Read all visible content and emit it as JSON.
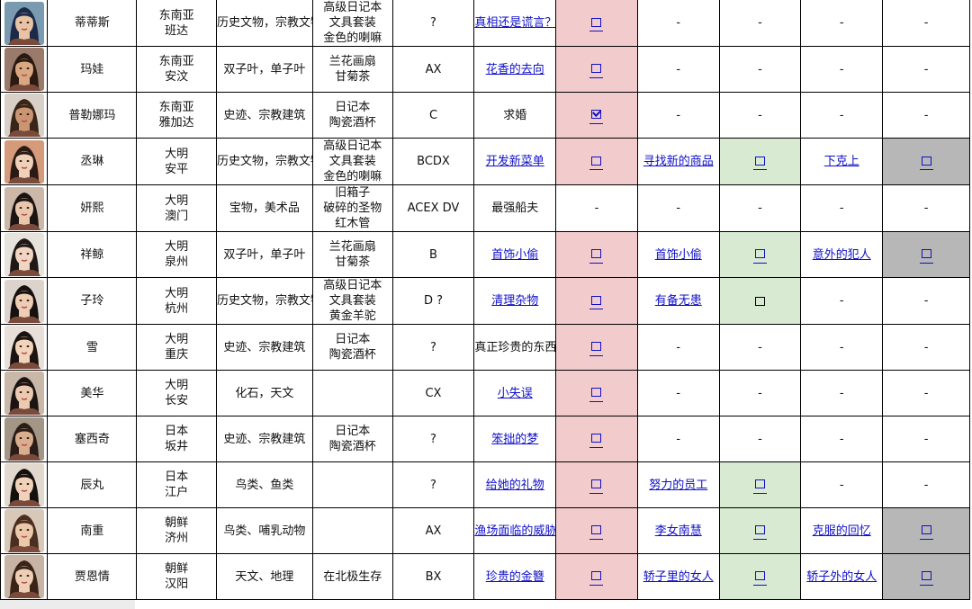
{
  "rows": [
    {
      "name": "蒂蒂斯",
      "region": "东南亚",
      "city": "班达",
      "interests": "历史文物，宗教文物",
      "items": [
        "高级日记本",
        "文具套装",
        "金色的喇嘛"
      ],
      "code": "?",
      "q1": "真相还是谎言？",
      "q1_link": true,
      "c1": "box",
      "q2": "-",
      "q2_link": false,
      "c2": "-",
      "q3": "-",
      "q3_link": false,
      "c3": "-",
      "portrait": {
        "skin": "#e8c4a4",
        "hair": "#1c2a4a",
        "bg": "#7a9ab0"
      }
    },
    {
      "name": "玛娃",
      "region": "东南亚",
      "city": "安汶",
      "interests": "双子叶，单子叶",
      "items": [
        "兰花画扇",
        "甘菊茶"
      ],
      "code": "AX",
      "q1": "花香的去向",
      "q1_link": true,
      "c1": "box",
      "q2": "-",
      "q2_link": false,
      "c2": "-",
      "q3": "-",
      "q3_link": false,
      "c3": "-",
      "portrait": {
        "skin": "#d9a882",
        "hair": "#2a1a12",
        "bg": "#9a7a6a"
      }
    },
    {
      "name": "普勒娜玛",
      "region": "东南亚",
      "city": "雅加达",
      "interests": "史迹、宗教建筑",
      "items": [
        "日记本",
        "陶瓷酒杯"
      ],
      "code": "C",
      "q1": "求婚",
      "q1_link": false,
      "c1": "checked",
      "q2": "-",
      "q2_link": false,
      "c2": "-",
      "q3": "-",
      "q3_link": false,
      "c3": "-",
      "portrait": {
        "skin": "#c99572",
        "hair": "#3a2418",
        "bg": "#d8d0c6"
      }
    },
    {
      "name": "丞琳",
      "region": "大明",
      "city": "安平",
      "interests": "历史文物，宗教文物",
      "items": [
        "高级日记本",
        "文具套装",
        "金色的喇嘛"
      ],
      "code": "BCDX",
      "q1": "开发新菜单",
      "q1_link": true,
      "c1": "box",
      "q2": "寻找新的商品",
      "q2_link": true,
      "c2": "box",
      "q3": "下克上",
      "q3_link": true,
      "c3": "box",
      "portrait": {
        "skin": "#efd0b8",
        "hair": "#2b1a14",
        "bg": "#d49a7a"
      }
    },
    {
      "name": "妍熙",
      "region": "大明",
      "city": "澳门",
      "interests": "宝物，美术品",
      "items": [
        "旧箱子",
        "破碎的圣物",
        "红木管"
      ],
      "code": "ACEX DV",
      "q1": "最强船夫",
      "q1_link": false,
      "c1": "-",
      "q2": "-",
      "q2_link": false,
      "c2": "-",
      "q3": "-",
      "q3_link": false,
      "c3": "-",
      "portrait": {
        "skin": "#e9c7ad",
        "hair": "#1a1412",
        "bg": "#ccb8a8"
      }
    },
    {
      "name": "祥鲸",
      "region": "大明",
      "city": "泉州",
      "interests": "双子叶，单子叶",
      "items": [
        "兰花画扇",
        "甘菊茶"
      ],
      "code": "B",
      "q1": "首饰小偷",
      "q1_link": true,
      "c1": "box",
      "q2": "首饰小偷",
      "q2_link": true,
      "c2": "box",
      "q3": "意外的犯人",
      "q3_link": true,
      "c3": "box",
      "portrait": {
        "skin": "#f0d6c2",
        "hair": "#1e1816",
        "bg": "#e6e2dc"
      }
    },
    {
      "name": "子玲",
      "region": "大明",
      "city": "杭州",
      "interests": "历史文物，宗教文物",
      "items": [
        "高级日记本",
        "文具套装",
        "黄金羊驼"
      ],
      "code": "D ?",
      "q1": "清理杂物",
      "q1_link": true,
      "c1": "box",
      "q2": "有备无患",
      "q2_link": true,
      "c2": "black",
      "q3": "-",
      "q3_link": false,
      "c3": "-",
      "portrait": {
        "skin": "#edcdb4",
        "hair": "#16110f",
        "bg": "#dcd4cc"
      }
    },
    {
      "name": "雪",
      "region": "大明",
      "city": "重庆",
      "interests": "史迹、宗教建筑",
      "items": [
        "日记本",
        "陶瓷酒杯"
      ],
      "code": "?",
      "q1": "真正珍贵的东西",
      "q1_link": false,
      "c1": "box",
      "q2": "-",
      "q2_link": false,
      "c2": "-",
      "q3": "-",
      "q3_link": false,
      "c3": "-",
      "portrait": {
        "skin": "#f2d4bc",
        "hair": "#1a1310",
        "bg": "#e8e0d8"
      }
    },
    {
      "name": "美华",
      "region": "大明",
      "city": "长安",
      "interests": "化石，天文",
      "items": [],
      "code": "CX",
      "q1": "小失误",
      "q1_link": true,
      "c1": "box",
      "q2": "-",
      "q2_link": false,
      "c2": "-",
      "q3": "-",
      "q3_link": false,
      "c3": "-",
      "portrait": {
        "skin": "#eccab0",
        "hair": "#1c1412",
        "bg": "#c9b8a8"
      }
    },
    {
      "name": "塞西奇",
      "region": "日本",
      "city": "坂井",
      "interests": "史迹、宗教建筑",
      "items": [
        "日记本",
        "陶瓷酒杯"
      ],
      "code": "?",
      "q1": "笨拙的梦",
      "q1_link": true,
      "c1": "box",
      "q2": "-",
      "q2_link": false,
      "c2": "-",
      "q3": "-",
      "q3_link": false,
      "c3": "-",
      "portrait": {
        "skin": "#d8ae8e",
        "hair": "#2a1c16",
        "bg": "#a49686"
      }
    },
    {
      "name": "辰丸",
      "region": "日本",
      "city": "江户",
      "interests": "鸟类、鱼类",
      "items": [],
      "code": "?",
      "q1": "给她的礼物",
      "q1_link": true,
      "c1": "box",
      "q2": "努力的员工",
      "q2_link": true,
      "c2": "box",
      "q3": "-",
      "q3_link": false,
      "c3": "-",
      "portrait": {
        "skin": "#f0d2ba",
        "hair": "#14100e",
        "bg": "#e2d8ce"
      }
    },
    {
      "name": "南重",
      "region": "朝鲜",
      "city": "济州",
      "interests": "鸟类、哺乳动物",
      "items": [],
      "code": "AX",
      "q1": "渔场面临的威胁",
      "q1_link": true,
      "c1": "box",
      "q2": "李女南慧",
      "q2_link": true,
      "c2": "box",
      "q3": "克服的回忆",
      "q3_link": true,
      "c3": "box",
      "portrait": {
        "skin": "#ecc8aa",
        "hair": "#4a2e20",
        "bg": "#d8c8b8"
      }
    },
    {
      "name": "贾恩情",
      "region": "朝鲜",
      "city": "汉阳",
      "interests": "天文、地理",
      "items": [
        "在北极生存"
      ],
      "code": "BX",
      "q1": "珍贵的金簪",
      "q1_link": true,
      "c1": "box",
      "q2": "轿子里的女人",
      "q2_link": true,
      "c2": "box",
      "q3": "轿子外的女人",
      "q3_link": true,
      "c3": "box",
      "portrait": {
        "skin": "#eecfb6",
        "hair": "#3a2418",
        "bg": "#c8b4a4"
      }
    }
  ],
  "colors": {
    "pink": "#f2cccc",
    "green": "#d9ead3",
    "gray": "#b7b7b7",
    "link": "#1010c8"
  }
}
